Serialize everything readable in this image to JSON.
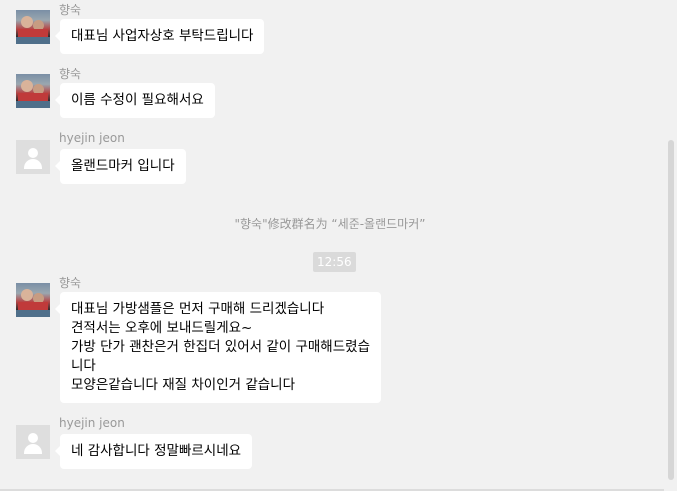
{
  "messages": [
    {
      "sender": "향숙",
      "lines": [
        "대표님 사업자상호 부탁드립니다"
      ]
    },
    {
      "sender": "향숙",
      "lines": [
        "이름 수정이 필요해서요"
      ]
    },
    {
      "sender": "hyejin jeon",
      "lines": [
        "올랜드마커 입니다"
      ]
    },
    {
      "sender": "향숙",
      "lines": [
        "대표님 가방샘플은 먼저 구매해 드리겠습니다",
        "견적서는 오후에 보내드릴게요~",
        "가방  단가 괜찬은거 한집더 있어서  같이 구매해드렸습",
        "니다",
        "모양은같습니다 재질 차이인거 같습니다"
      ]
    },
    {
      "sender": "hyejin jeon",
      "lines": [
        "네 감사합니다 정말빠르시네요"
      ]
    }
  ],
  "system_notice": "\"향숙\"修改群名为 “세준-올랜드마커”",
  "timestamp": "12:56"
}
